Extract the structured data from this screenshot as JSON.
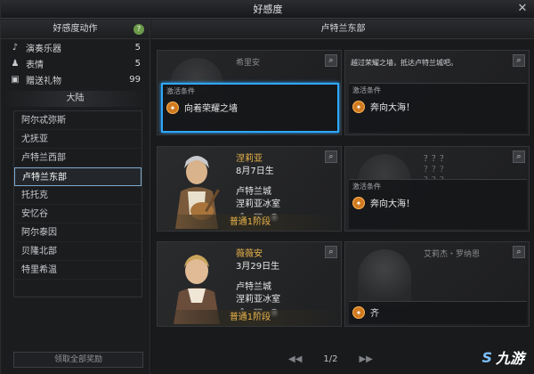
{
  "window": {
    "title": "好感度"
  },
  "left": {
    "actions_title": "好感度动作",
    "actions": [
      {
        "icon": "music-note-icon",
        "label": "演奏乐器",
        "count": "5"
      },
      {
        "icon": "emote-icon",
        "label": "表情",
        "count": "5"
      },
      {
        "icon": "gift-icon",
        "label": "赠送礼物",
        "count": "99"
      }
    ],
    "continent_title": "大陆",
    "regions": [
      "阿尔忒弥斯",
      "尤抚亚",
      "卢特兰西部",
      "卢特兰东部",
      "托托克",
      "安忆谷",
      "阿尔泰因",
      "贝隆北部",
      "特里希温"
    ],
    "selected_region": "卢特兰东部",
    "claim_all": "领取全部奖励"
  },
  "right": {
    "region_title": "卢特兰东部",
    "cards": [
      {
        "name": "希里安",
        "condition_label": "激活条件",
        "condition": "向着荣耀之墙"
      },
      {
        "description": "越过荣耀之墙，抵达卢特兰城吧。",
        "condition_label": "激活条件",
        "condition": "奔向大海！"
      },
      {
        "name": "涅莉亚",
        "birthday": "8月7日生",
        "city": "卢特兰城",
        "place": "涅莉亚冰室",
        "stage": "普通1阶段"
      },
      {
        "name": "？？？",
        "qq1": "？？？",
        "qq2": "？？？",
        "condition_label": "激活条件",
        "condition": "奔向大海！"
      },
      {
        "name": "薇薇安",
        "birthday": "3月29日生",
        "city": "卢特兰城",
        "place": "涅莉亚冰室",
        "stage": "普通1阶段"
      },
      {
        "name": "艾莉杰・罗纳恩",
        "condition": "齐"
      }
    ],
    "pager": {
      "prev": "◀◀",
      "page": "1/2",
      "next": "▶▶"
    }
  },
  "watermark": {
    "text": "九游",
    "logo": "S"
  }
}
